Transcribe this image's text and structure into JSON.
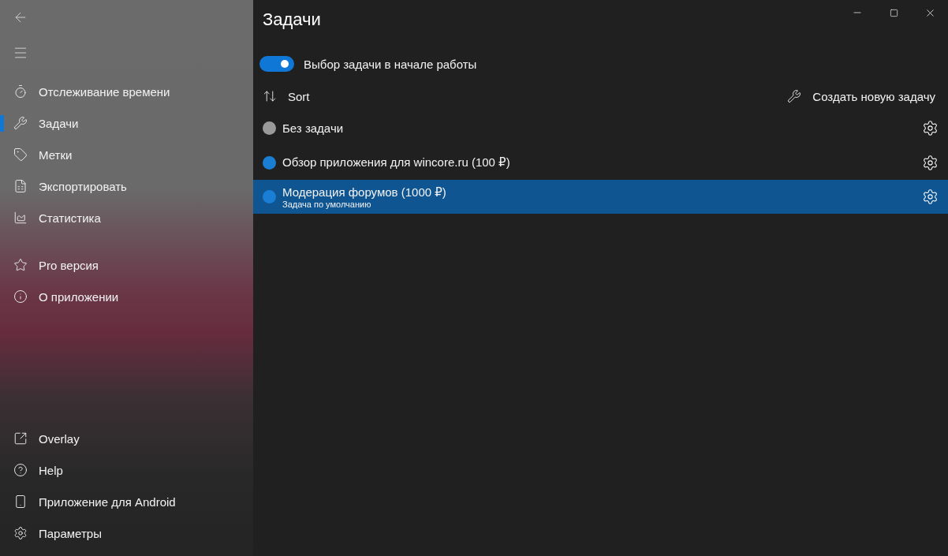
{
  "window": {
    "title": "Задачи"
  },
  "sidebar": {
    "items": [
      {
        "kind": "timer",
        "label": "Отслеживание времени",
        "selected": false
      },
      {
        "kind": "wrench",
        "label": "Задачи",
        "selected": true
      },
      {
        "kind": "tag",
        "label": "Метки",
        "selected": false
      },
      {
        "kind": "spreadsheet",
        "label": "Экспортировать",
        "selected": false
      },
      {
        "kind": "chart",
        "label": "Статистика",
        "selected": false
      },
      {
        "kind": "star",
        "label": "Pro версия",
        "selected": false
      },
      {
        "kind": "info",
        "label": "О приложении",
        "selected": false
      }
    ],
    "footer_items": [
      {
        "kind": "overlay",
        "label": "Overlay"
      },
      {
        "kind": "help",
        "label": "Help"
      },
      {
        "kind": "phone",
        "label": "Приложение для Android"
      },
      {
        "kind": "settings",
        "label": "Параметры"
      }
    ]
  },
  "toggle": {
    "label": "Выбор задачи в начале работы",
    "on": true
  },
  "toolbar": {
    "sort": "Sort",
    "create": "Создать новую задачу"
  },
  "tasks": [
    {
      "name": "Без задачи",
      "color": "#9a9a9a",
      "selected": false
    },
    {
      "name": "Обзор приложения для wincore.ru (100 ₽)",
      "color": "#1a7fd4",
      "selected": false
    },
    {
      "name": "Модерация форумов (1000 ₽)",
      "subtitle": "Задача по умолчанию",
      "color": "#1a7fd4",
      "selected": true
    }
  ]
}
